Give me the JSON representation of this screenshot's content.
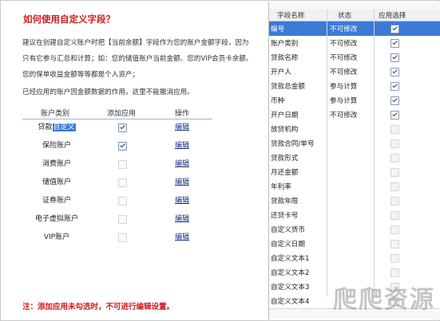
{
  "left": {
    "title": "如何使用自定义字段？",
    "desc1_l1": "建议在创建自定义账户时把【当前余额】字段作为您的账户金额字段，因为",
    "desc1_l2": "只有它参与汇总和计算；如：您的储值账户当前金额、您的VIP会员卡余额、",
    "desc1_l3": "您的保单收益金额等等都是个人资产；",
    "desc2": "已经应用的账户因金额数据的作用，这里不能撤消应用。",
    "headers": {
      "category": "账户类别",
      "add": "添加应用",
      "op": "操作"
    },
    "rows": [
      {
        "name_a": "贷款",
        "name_b": "自定义",
        "checked": true,
        "enabled": true,
        "edit": "编辑"
      },
      {
        "name": "保险账户",
        "checked": true,
        "enabled": true,
        "edit": "编辑"
      },
      {
        "name": "消费账户",
        "checked": false,
        "enabled": false,
        "edit": "编辑"
      },
      {
        "name": "储值账户",
        "checked": false,
        "enabled": false,
        "edit": "编辑"
      },
      {
        "name": "证券账户",
        "checked": false,
        "enabled": false,
        "edit": "编辑"
      },
      {
        "name": "电子虚拟账户",
        "checked": false,
        "enabled": false,
        "edit": "编辑"
      },
      {
        "name": "VIP账户",
        "checked": false,
        "enabled": false,
        "edit": "编辑"
      }
    ],
    "note": "注：添加应用未勾选时，不可进行编辑设置。"
  },
  "right": {
    "headers": {
      "field": "字段名称",
      "status": "状态",
      "apply": "应用选择"
    },
    "rows": [
      {
        "field": "编号",
        "status": "不可修改",
        "checked": true,
        "selected": true
      },
      {
        "field": "账户类别",
        "status": "不可修改",
        "checked": true
      },
      {
        "field": "贷款名称",
        "status": "不可修改",
        "checked": true
      },
      {
        "field": "开户人",
        "status": "不可修改",
        "checked": true
      },
      {
        "field": "贷款总金额",
        "status": "参与计算",
        "checked": true
      },
      {
        "field": "币种",
        "status": "参与计算",
        "checked": true
      },
      {
        "field": "开户日期",
        "status": "不可修改",
        "checked": true
      },
      {
        "field": "放贷机构",
        "status": "",
        "checked": false
      },
      {
        "field": "贷款合同/单号",
        "status": "",
        "checked": false
      },
      {
        "field": "贷款形式",
        "status": "",
        "checked": false
      },
      {
        "field": "月还金额",
        "status": "",
        "checked": false
      },
      {
        "field": "年利率",
        "status": "",
        "checked": false
      },
      {
        "field": "贷款年限",
        "status": "",
        "checked": false
      },
      {
        "field": "还贷卡号",
        "status": "",
        "checked": false
      },
      {
        "field": "自定义货币",
        "status": "",
        "checked": false
      },
      {
        "field": "自定义日期",
        "status": "",
        "checked": false
      },
      {
        "field": "自定义文本1",
        "status": "",
        "checked": false
      },
      {
        "field": "自定义文本2",
        "status": "",
        "checked": false
      },
      {
        "field": "自定义文本3",
        "status": "",
        "checked": false
      },
      {
        "field": "自定义文本4",
        "status": "",
        "checked": false
      }
    ]
  },
  "watermark": "爬爬资源"
}
